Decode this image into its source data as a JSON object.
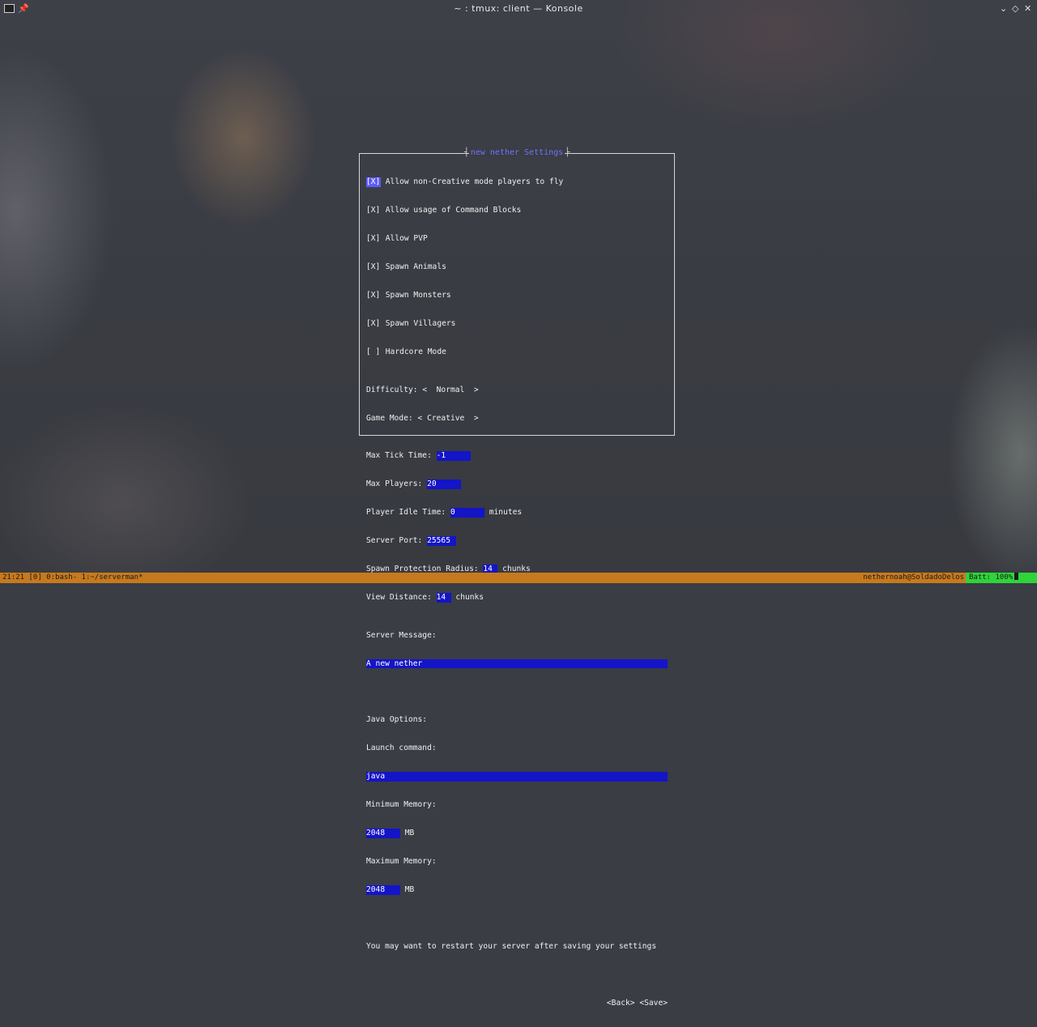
{
  "window": {
    "title": "~ : tmux: client — Konsole"
  },
  "icons": {
    "app": "terminal-icon",
    "pin": "pin-icon",
    "minimize": "chevron-down-icon",
    "maximize": "diamond-icon",
    "close": "close-icon"
  },
  "dialog": {
    "title": "new nether Settings",
    "checkboxes": [
      {
        "mark": "[X]",
        "label": "Allow non-Creative mode players to fly",
        "checked": true,
        "focused": true
      },
      {
        "mark": "[X]",
        "label": "Allow usage of Command Blocks",
        "checked": true
      },
      {
        "mark": "[X]",
        "label": "Allow PVP",
        "checked": true
      },
      {
        "mark": "[X]",
        "label": "Spawn Animals",
        "checked": true
      },
      {
        "mark": "[X]",
        "label": "Spawn Monsters",
        "checked": true
      },
      {
        "mark": "[X]",
        "label": "Spawn Villagers",
        "checked": true
      },
      {
        "mark": "[ ]",
        "label": "Hardcore Mode",
        "checked": false
      }
    ],
    "difficulty": {
      "label": "Difficulty: ",
      "left": "<",
      "value": "Normal",
      "right": ">"
    },
    "game_mode": {
      "label": "Game Mode: ",
      "left": "<",
      "value": "Creative",
      "right": ">"
    },
    "max_tick_time": {
      "label": "Max Tick Time: ",
      "value": "-1"
    },
    "max_players": {
      "label": "Max Players: ",
      "value": "20"
    },
    "player_idle_time": {
      "label": "Player Idle Time: ",
      "value": "0",
      "unit": " minutes"
    },
    "server_port": {
      "label": "Server Port: ",
      "value": "25565"
    },
    "spawn_protection": {
      "label": "Spawn Protection Radius: ",
      "value": "14",
      "unit": " chunks"
    },
    "view_distance": {
      "label": "View Distance: ",
      "value": "14",
      "unit": " chunks"
    },
    "server_message": {
      "label": "Server Message:",
      "value": "A new nether"
    },
    "java_options": {
      "label": "Java Options:"
    },
    "launch_command": {
      "label": "Launch command:",
      "value": "java"
    },
    "min_memory": {
      "label": "Minimum Memory:",
      "value": "2048",
      "unit": " MB"
    },
    "max_memory": {
      "label": "Maximum Memory:",
      "value": "2048",
      "unit": " MB"
    },
    "notice": "You may want to restart your server after saving your settings",
    "back_button": "<Back>",
    "save_button": "<Save>"
  },
  "statusbar": {
    "left": "21:21 [0] 0:bash- 1:~/serverman*",
    "right": "nethernoah@SoldadoDelos",
    "battery": "Batt: 100%",
    "colors": {
      "bar": "#c77a1d",
      "battery": "#2fd43a"
    }
  },
  "colors": {
    "field_bg": "#1414c8",
    "dialog_title": "#6f72ff",
    "focused_checkbox": "#5b5bff"
  }
}
